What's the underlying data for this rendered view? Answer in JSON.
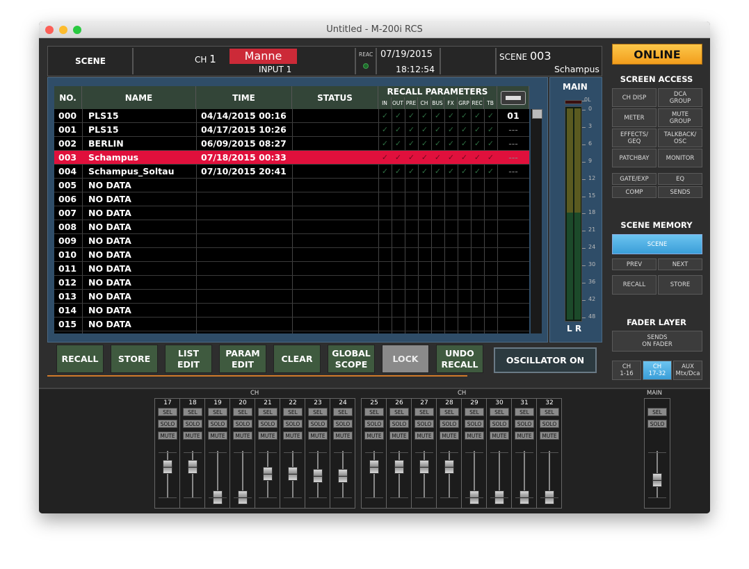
{
  "window": {
    "title": "Untitled - M-200i RCS"
  },
  "header": {
    "scene_label": "SCENE",
    "ch_label": "CH",
    "ch_number": "1",
    "ch_name": "Manne",
    "input_label": "INPUT 1",
    "reac_label": "REAC",
    "date": "07/19/2015",
    "time": "18:12:54",
    "scene_num_label": "SCENE",
    "scene_num": "003",
    "scene_name": "Schampus"
  },
  "table": {
    "headers": {
      "no": "NO.",
      "name": "NAME",
      "time": "TIME",
      "status": "STATUS",
      "recall": "RECALL PARAMETERS"
    },
    "param_cols": [
      "IN",
      "OUT",
      "PRE",
      "CH",
      "BUS",
      "FX",
      "GRP",
      "REC",
      "TB"
    ],
    "rows": [
      {
        "no": "000",
        "name": "PLS15",
        "time": "04/14/2015 00:16",
        "usb": "01",
        "checks": true
      },
      {
        "no": "001",
        "name": "PLS15",
        "time": "04/17/2015 10:26",
        "usb": "---",
        "checks": true
      },
      {
        "no": "002",
        "name": "BERLIN",
        "time": "06/09/2015 08:27",
        "usb": "---",
        "checks": true
      },
      {
        "no": "003",
        "name": "Schampus",
        "time": "07/18/2015 00:33",
        "usb": "---",
        "checks": true,
        "selected": true
      },
      {
        "no": "004",
        "name": "Schampus_Soltau",
        "time": "07/10/2015 20:41",
        "usb": "---",
        "checks": true
      },
      {
        "no": "005",
        "name": "NO DATA",
        "time": "",
        "usb": "",
        "checks": false
      },
      {
        "no": "006",
        "name": "NO DATA",
        "time": "",
        "usb": "",
        "checks": false
      },
      {
        "no": "007",
        "name": "NO DATA",
        "time": "",
        "usb": "",
        "checks": false
      },
      {
        "no": "008",
        "name": "NO DATA",
        "time": "",
        "usb": "",
        "checks": false
      },
      {
        "no": "009",
        "name": "NO DATA",
        "time": "",
        "usb": "",
        "checks": false
      },
      {
        "no": "010",
        "name": "NO DATA",
        "time": "",
        "usb": "",
        "checks": false
      },
      {
        "no": "011",
        "name": "NO DATA",
        "time": "",
        "usb": "",
        "checks": false
      },
      {
        "no": "012",
        "name": "NO DATA",
        "time": "",
        "usb": "",
        "checks": false
      },
      {
        "no": "013",
        "name": "NO DATA",
        "time": "",
        "usb": "",
        "checks": false
      },
      {
        "no": "014",
        "name": "NO DATA",
        "time": "",
        "usb": "",
        "checks": false
      },
      {
        "no": "015",
        "name": "NO DATA",
        "time": "",
        "usb": "",
        "checks": false
      }
    ]
  },
  "meter": {
    "title": "MAIN",
    "scale": [
      "0L",
      "0",
      "3",
      "6",
      "9",
      "12",
      "15",
      "18",
      "21",
      "24",
      "30",
      "36",
      "42",
      "48"
    ],
    "lr": "L R"
  },
  "buttons": [
    {
      "label": "RECALL"
    },
    {
      "label": "STORE"
    },
    {
      "label": "LIST\nEDIT"
    },
    {
      "label": "PARAM\nEDIT"
    },
    {
      "label": "CLEAR"
    },
    {
      "label": "GLOBAL\nSCOPE"
    },
    {
      "label": "LOCK"
    },
    {
      "label": "UNDO\nRECALL"
    }
  ],
  "oscillator": "OSCILLATOR ON",
  "right": {
    "online": "ONLINE",
    "screen_access": "SCREEN ACCESS",
    "sa_buttons": [
      "CH DISP",
      "DCA\nGROUP",
      "METER",
      "MUTE\nGROUP",
      "EFFECTS/\nGEQ",
      "TALKBACK/\nOSC",
      "PATCHBAY",
      "MONITOR"
    ],
    "sa_small": [
      "GATE/EXP",
      "EQ",
      "COMP",
      "SENDS"
    ],
    "scene_memory": "SCENE MEMORY",
    "scene_btn": "SCENE",
    "prev": "PREV",
    "next": "NEXT",
    "recall": "RECALL",
    "store": "STORE",
    "fader_layer": "FADER LAYER",
    "sends_on_fader": "SENDS\nON FADER",
    "layers": [
      "CH\n1-16",
      "CH\n17-32",
      "AUX\nMtx/Dca"
    ]
  },
  "strips": {
    "group_label": "CH",
    "sel": "SEL",
    "solo": "SOLO",
    "mute": "MUTE",
    "channels": [
      {
        "n": "17",
        "level": 0.78
      },
      {
        "n": "18",
        "level": 0.78
      },
      {
        "n": "19",
        "level": 0.02
      },
      {
        "n": "20",
        "level": 0.02
      },
      {
        "n": "21",
        "level": 0.6
      },
      {
        "n": "22",
        "level": 0.6
      },
      {
        "n": "23",
        "level": 0.55
      },
      {
        "n": "24",
        "level": 0.55
      },
      {
        "n": "25",
        "level": 0.78
      },
      {
        "n": "26",
        "level": 0.78
      },
      {
        "n": "27",
        "level": 0.78
      },
      {
        "n": "28",
        "level": 0.78
      },
      {
        "n": "29",
        "level": 0.02
      },
      {
        "n": "30",
        "level": 0.02
      },
      {
        "n": "31",
        "level": 0.02
      },
      {
        "n": "32",
        "level": 0.02
      }
    ],
    "main_label": "MAIN",
    "main_level": 0.45
  },
  "colors": {
    "selected_row": "#e0103c",
    "online": "#f6b32e",
    "scene_active": "#4aaee6",
    "layer_active": "#4aaee6"
  }
}
